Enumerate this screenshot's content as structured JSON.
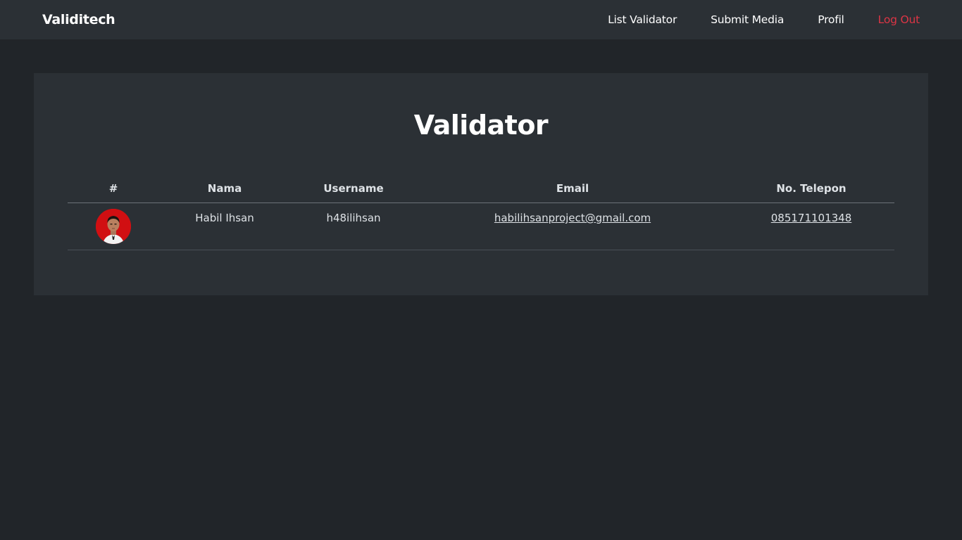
{
  "navbar": {
    "brand": "Validitech",
    "links": [
      {
        "label": "List Validator"
      },
      {
        "label": "Submit Media"
      },
      {
        "label": "Profil"
      },
      {
        "label": "Log Out"
      }
    ]
  },
  "main": {
    "title": "Validator",
    "table": {
      "headers": [
        "#",
        "Nama",
        "Username",
        "Email",
        "No. Telepon"
      ],
      "rows": [
        {
          "avatar": "user-photo-avatar",
          "nama": "Habil Ihsan",
          "username": "h48ilihsan",
          "email": "habilihsanproject@gmail.com",
          "telepon": "085171101348"
        }
      ]
    }
  },
  "colors": {
    "page_bg": "#212529",
    "panel_bg": "#2b3035",
    "logout": "#dc3545",
    "avatar_bg": "#d10f12"
  }
}
